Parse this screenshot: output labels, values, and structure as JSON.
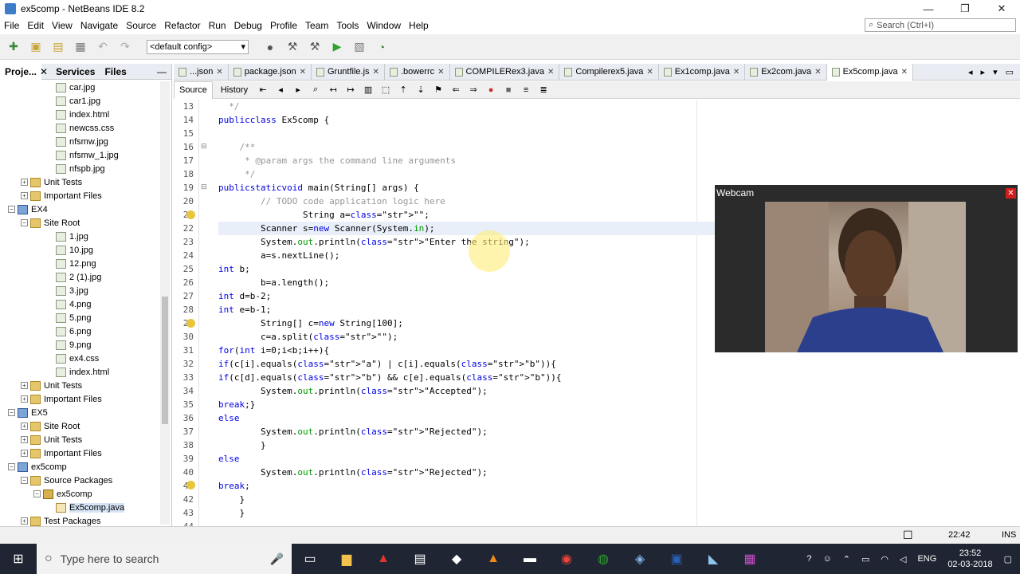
{
  "window": {
    "title": "ex5comp - NetBeans IDE 8.2",
    "min_glyph": "—",
    "max_glyph": "❐",
    "close_glyph": "✕"
  },
  "menu": [
    "File",
    "Edit",
    "View",
    "Navigate",
    "Source",
    "Refactor",
    "Run",
    "Debug",
    "Profile",
    "Team",
    "Tools",
    "Window",
    "Help"
  ],
  "search": {
    "placeholder": "Search (Ctrl+I)"
  },
  "toolbar": {
    "config": "<default config>"
  },
  "left_panel": {
    "tabs": [
      "Proje...",
      "Services",
      "Files"
    ],
    "tree": [
      {
        "indent": 4,
        "icon": "file",
        "label": "car.jpg"
      },
      {
        "indent": 4,
        "icon": "file",
        "label": "car1.jpg"
      },
      {
        "indent": 4,
        "icon": "file",
        "label": "index.html"
      },
      {
        "indent": 4,
        "icon": "file",
        "label": "newcss.css"
      },
      {
        "indent": 4,
        "icon": "file",
        "label": "nfsmw.jpg"
      },
      {
        "indent": 4,
        "icon": "file",
        "label": "nfsmw_1.jpg"
      },
      {
        "indent": 4,
        "icon": "file",
        "label": "nfspb.jpg"
      },
      {
        "indent": 2,
        "icon": "folder",
        "label": "Unit Tests",
        "exp": "+"
      },
      {
        "indent": 2,
        "icon": "folder",
        "label": "Important Files",
        "exp": "+"
      },
      {
        "indent": 1,
        "icon": "proj",
        "label": "EX4",
        "exp": "−"
      },
      {
        "indent": 2,
        "icon": "folder",
        "label": "Site Root",
        "exp": "−"
      },
      {
        "indent": 4,
        "icon": "file",
        "label": "1.jpg"
      },
      {
        "indent": 4,
        "icon": "file",
        "label": "10.jpg"
      },
      {
        "indent": 4,
        "icon": "file",
        "label": "12.png"
      },
      {
        "indent": 4,
        "icon": "file",
        "label": "2 (1).jpg"
      },
      {
        "indent": 4,
        "icon": "file",
        "label": "3.jpg"
      },
      {
        "indent": 4,
        "icon": "file",
        "label": "4.png"
      },
      {
        "indent": 4,
        "icon": "file",
        "label": "5.png"
      },
      {
        "indent": 4,
        "icon": "file",
        "label": "6.png"
      },
      {
        "indent": 4,
        "icon": "file",
        "label": "9.png"
      },
      {
        "indent": 4,
        "icon": "file",
        "label": "ex4.css"
      },
      {
        "indent": 4,
        "icon": "file",
        "label": "index.html"
      },
      {
        "indent": 2,
        "icon": "folder",
        "label": "Unit Tests",
        "exp": "+"
      },
      {
        "indent": 2,
        "icon": "folder",
        "label": "Important Files",
        "exp": "+"
      },
      {
        "indent": 1,
        "icon": "proj",
        "label": "EX5",
        "exp": "−"
      },
      {
        "indent": 2,
        "icon": "folder",
        "label": "Site Root",
        "exp": "+"
      },
      {
        "indent": 2,
        "icon": "folder",
        "label": "Unit Tests",
        "exp": "+"
      },
      {
        "indent": 2,
        "icon": "folder",
        "label": "Important Files",
        "exp": "+"
      },
      {
        "indent": 1,
        "icon": "proj",
        "label": "ex5comp",
        "exp": "−"
      },
      {
        "indent": 2,
        "icon": "folder",
        "label": "Source Packages",
        "exp": "−"
      },
      {
        "indent": 3,
        "icon": "pkg",
        "label": "ex5comp",
        "exp": "−"
      },
      {
        "indent": 4,
        "icon": "java",
        "label": "Ex5comp.java"
      },
      {
        "indent": 2,
        "icon": "folder",
        "label": "Test Packages",
        "exp": "+"
      }
    ]
  },
  "editor_tabs": [
    "...json",
    "package.json",
    "Gruntfile.js",
    ".bowerrc",
    "COMPILERex3.java",
    "Compilerex5.java",
    "Ex1comp.java",
    "Ex2com.java",
    "Ex5comp.java"
  ],
  "active_tab": "Ex5comp.java",
  "editor_toolbar": {
    "source": "Source",
    "history": "History"
  },
  "code": [
    {
      "n": "13",
      "t": "  */",
      "cls": "cm"
    },
    {
      "n": "14",
      "t": "public class Ex5comp {",
      "cls": ""
    },
    {
      "n": "15",
      "t": "",
      "cls": ""
    },
    {
      "n": "16",
      "t": "    /**",
      "cls": "cm"
    },
    {
      "n": "17",
      "t": "     * @param args the command line arguments",
      "cls": "cm"
    },
    {
      "n": "18",
      "t": "     */",
      "cls": "cm"
    },
    {
      "n": "19",
      "t": "    public static void main(String[] args) {",
      "cls": ""
    },
    {
      "n": "20",
      "t": "        // TODO code application logic here",
      "cls": "cm"
    },
    {
      "n": "21",
      "t": "                String a=\"\";",
      "cls": ""
    },
    {
      "n": "22",
      "t": "        Scanner s=new Scanner(System.in);",
      "cls": "",
      "current": true
    },
    {
      "n": "23",
      "t": "        System.out.println(\"Enter the string\");",
      "cls": ""
    },
    {
      "n": "24",
      "t": "        a=s.nextLine();",
      "cls": ""
    },
    {
      "n": "25",
      "t": "        int b;",
      "cls": ""
    },
    {
      "n": "26",
      "t": "        b=a.length();",
      "cls": ""
    },
    {
      "n": "27",
      "t": "        int d=b-2;",
      "cls": ""
    },
    {
      "n": "28",
      "t": "        int e=b-1;",
      "cls": ""
    },
    {
      "n": "29",
      "t": "        String[] c=new String[100];",
      "cls": ""
    },
    {
      "n": "30",
      "t": "        c=a.split(\"\");",
      "cls": ""
    },
    {
      "n": "31",
      "t": "        for(int i=0;i<b;i++){",
      "cls": ""
    },
    {
      "n": "32",
      "t": "        if(c[i].equals(\"a\") | c[i].equals(\"b\")){",
      "cls": ""
    },
    {
      "n": "33",
      "t": "        if(c[d].equals(\"b\") && c[e].equals(\"b\")){",
      "cls": ""
    },
    {
      "n": "34",
      "t": "        System.out.println(\"Accepted\");",
      "cls": ""
    },
    {
      "n": "35",
      "t": "        break;}",
      "cls": ""
    },
    {
      "n": "36",
      "t": "        else",
      "cls": ""
    },
    {
      "n": "37",
      "t": "        System.out.println(\"Rejected\");",
      "cls": ""
    },
    {
      "n": "38",
      "t": "        }",
      "cls": ""
    },
    {
      "n": "39",
      "t": "        else",
      "cls": ""
    },
    {
      "n": "40",
      "t": "        System.out.println(\"Rejected\");",
      "cls": ""
    },
    {
      "n": "41",
      "t": "        break;",
      "cls": ""
    },
    {
      "n": "42",
      "t": "    }",
      "cls": ""
    },
    {
      "n": "43",
      "t": "    }",
      "cls": ""
    },
    {
      "n": "44",
      "t": "",
      "cls": ""
    }
  ],
  "webcam": {
    "title": "Webcam"
  },
  "status": {
    "position": "22:42",
    "mode": "INS"
  },
  "taskbar": {
    "search_placeholder": "Type here to search",
    "lang": "ENG",
    "time": "23:52",
    "date": "02-03-2018"
  }
}
